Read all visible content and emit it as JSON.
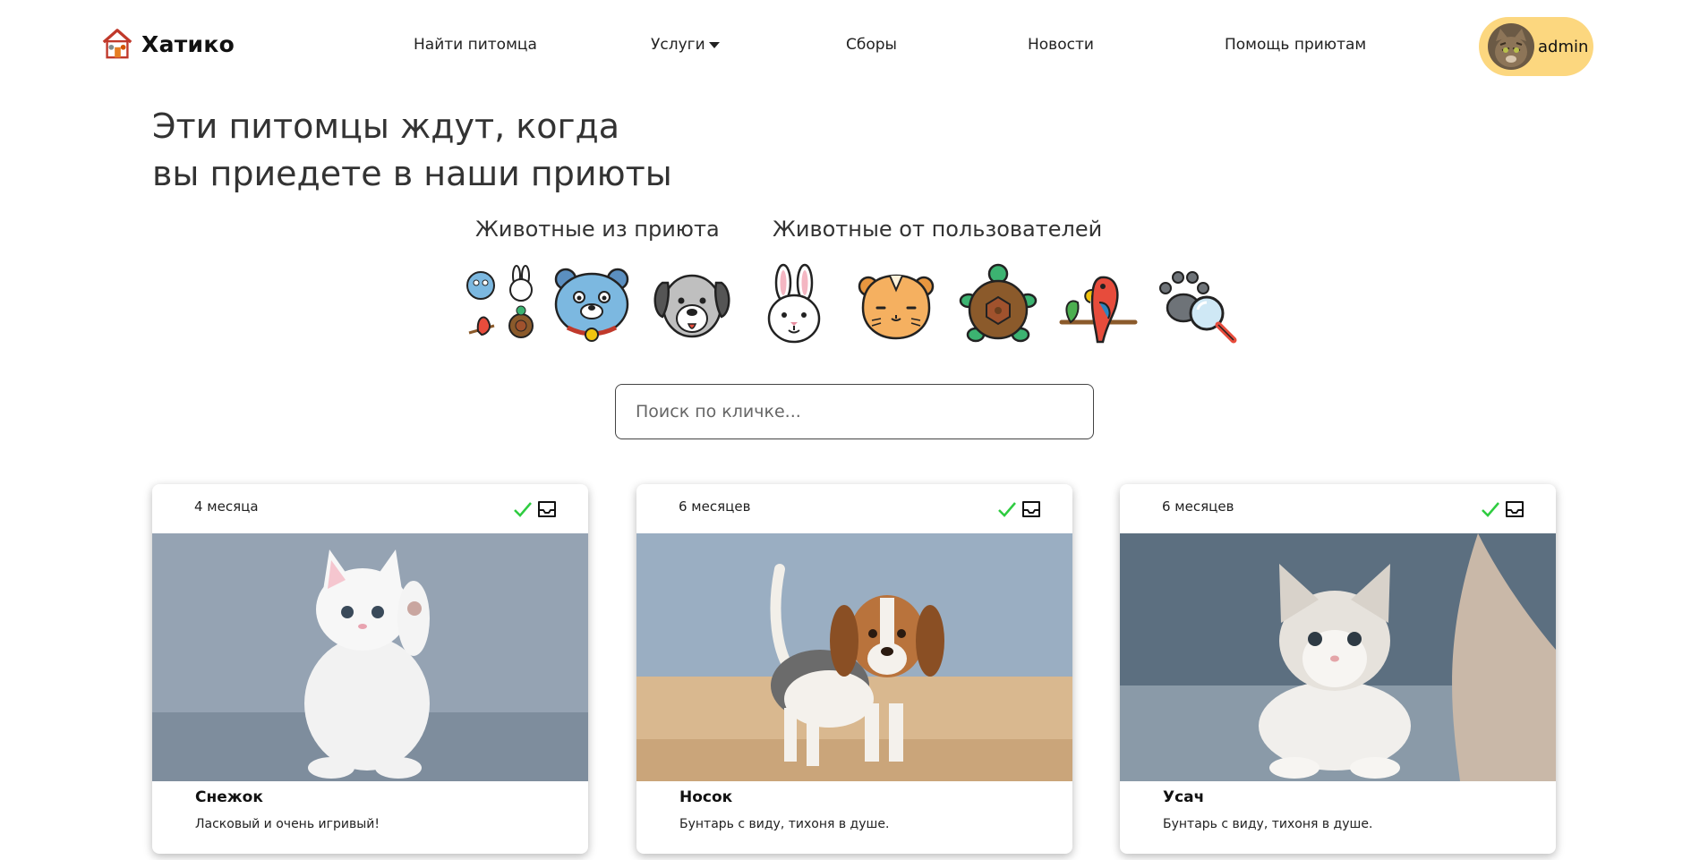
{
  "header": {
    "brand": "Хатико",
    "nav": [
      "Найти питомца",
      "Услуги",
      "Сборы",
      "Новости",
      "Помощь приютам"
    ],
    "user": "admin"
  },
  "headline": {
    "line1": "Эти питомцы ждут, когда",
    "line2": "вы приедете в наши приюты"
  },
  "tabs": {
    "shelter": "Животные из приюта",
    "users": "Животные от пользователей"
  },
  "categories": [
    "all-animals-icon",
    "cat-icon",
    "dog-icon",
    "rabbit-icon",
    "hamster-icon",
    "turtle-icon",
    "parrot-icon",
    "lost-pet-search-icon"
  ],
  "search": {
    "placeholder": "Поиск по кличке..."
  },
  "cards": [
    {
      "age": "4 месяца",
      "name": "Снежок",
      "description": "Ласковый и очень игривый!"
    },
    {
      "age": "6 месяцев",
      "name": "Носок",
      "description": "Бунтарь с виду, тихоня в душе."
    },
    {
      "age": "6 месяцев",
      "name": "Усач",
      "description": "Бунтарь с виду, тихоня в душе."
    }
  ],
  "colors": {
    "user_button": "#fcd77f",
    "check": "#2ecc40"
  }
}
